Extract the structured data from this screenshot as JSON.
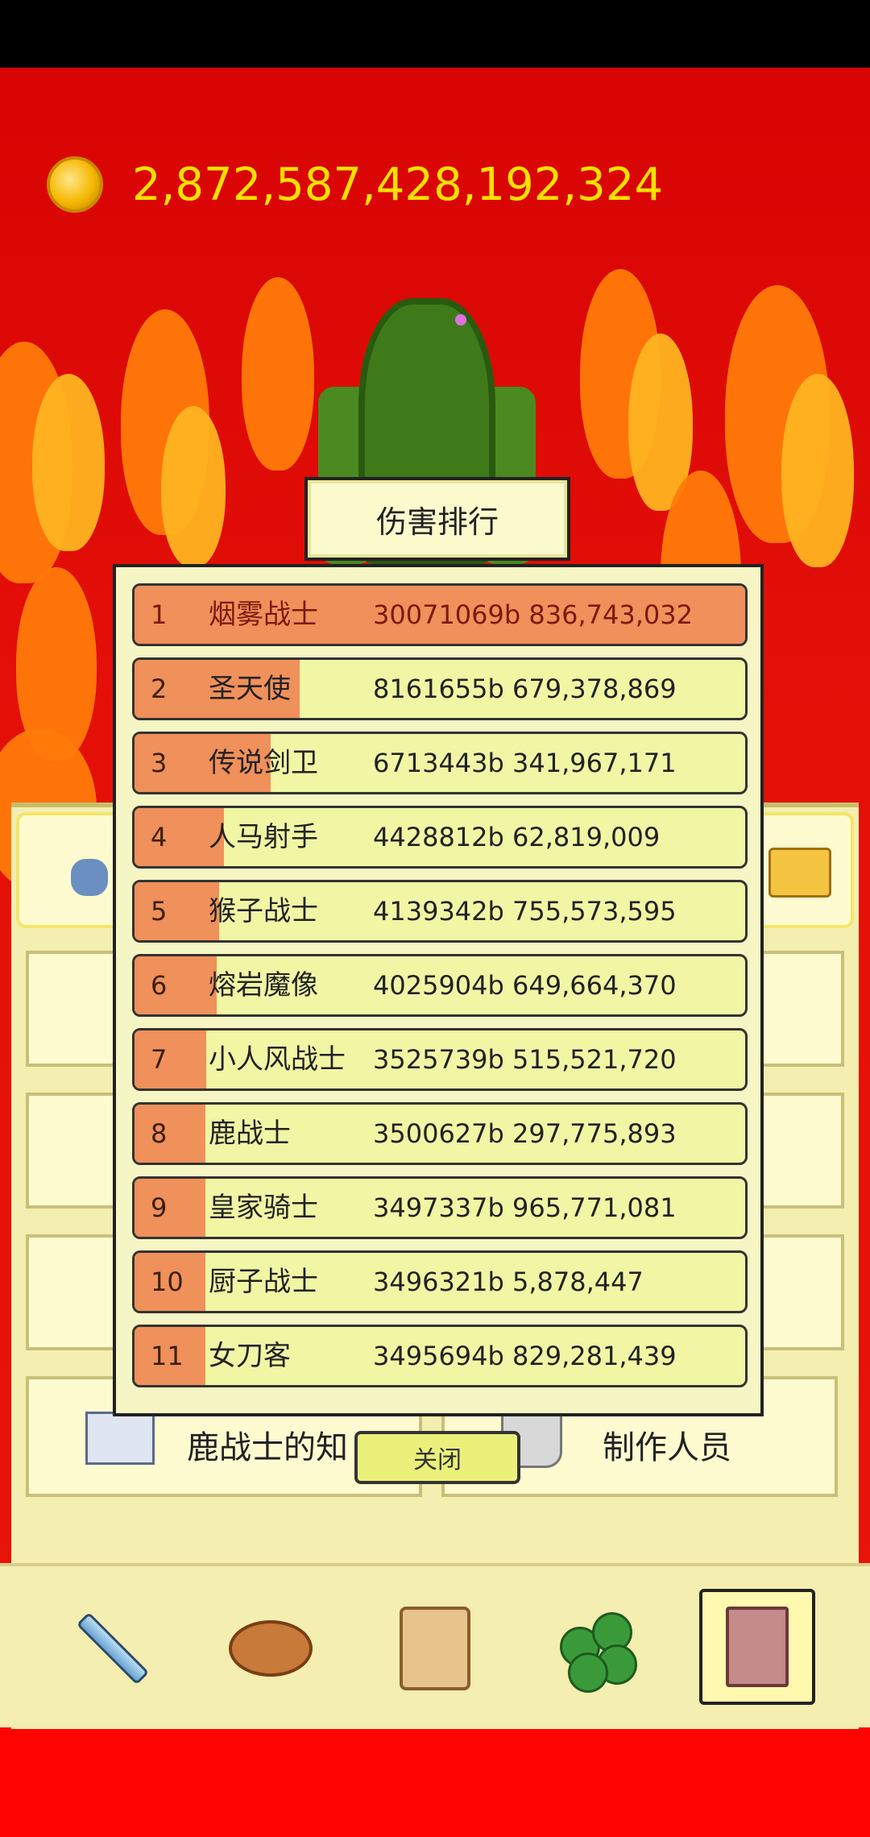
{
  "currency": {
    "value": "2,872,587,428,192,324",
    "icon": "gold-coin-icon"
  },
  "ranking": {
    "title": "伤害排行",
    "close_label": "关闭",
    "rows": [
      {
        "rank": "1",
        "name": "烟雾战士",
        "score": "30071069b 836,743,032",
        "share": 1.0
      },
      {
        "rank": "2",
        "name": "圣天使",
        "score": "8161655b 679,378,869",
        "share": 0.271
      },
      {
        "rank": "3",
        "name": "传说剑卫",
        "score": "6713443b 341,967,171",
        "share": 0.223
      },
      {
        "rank": "4",
        "name": "人马射手",
        "score": "4428812b 62,819,009",
        "share": 0.147
      },
      {
        "rank": "5",
        "name": "猴子战士",
        "score": "4139342b 755,573,595",
        "share": 0.138
      },
      {
        "rank": "6",
        "name": "熔岩魔像",
        "score": "4025904b 649,664,370",
        "share": 0.134
      },
      {
        "rank": "7",
        "name": "小人风战士",
        "score": "3525739b 515,521,720",
        "share": 0.117
      },
      {
        "rank": "8",
        "name": "鹿战士",
        "score": "3500627b 297,775,893",
        "share": 0.116
      },
      {
        "rank": "9",
        "name": "皇家骑士",
        "score": "3497337b 965,771,081",
        "share": 0.116
      },
      {
        "rank": "10",
        "name": "厨子战士",
        "score": "3496321b 5,878,447",
        "share": 0.116
      },
      {
        "rank": "11",
        "name": "女刀客",
        "score": "3495694b 829,281,439",
        "share": 0.116
      }
    ]
  },
  "background_menu": {
    "deer_knowledge": "鹿战士的知",
    "credits": "制作人员"
  },
  "nav": {
    "items": [
      {
        "icon": "sword-icon"
      },
      {
        "icon": "bread-icon"
      },
      {
        "icon": "scroll-icon"
      },
      {
        "icon": "clover-icon"
      },
      {
        "icon": "book-icon",
        "active": true
      }
    ]
  }
}
